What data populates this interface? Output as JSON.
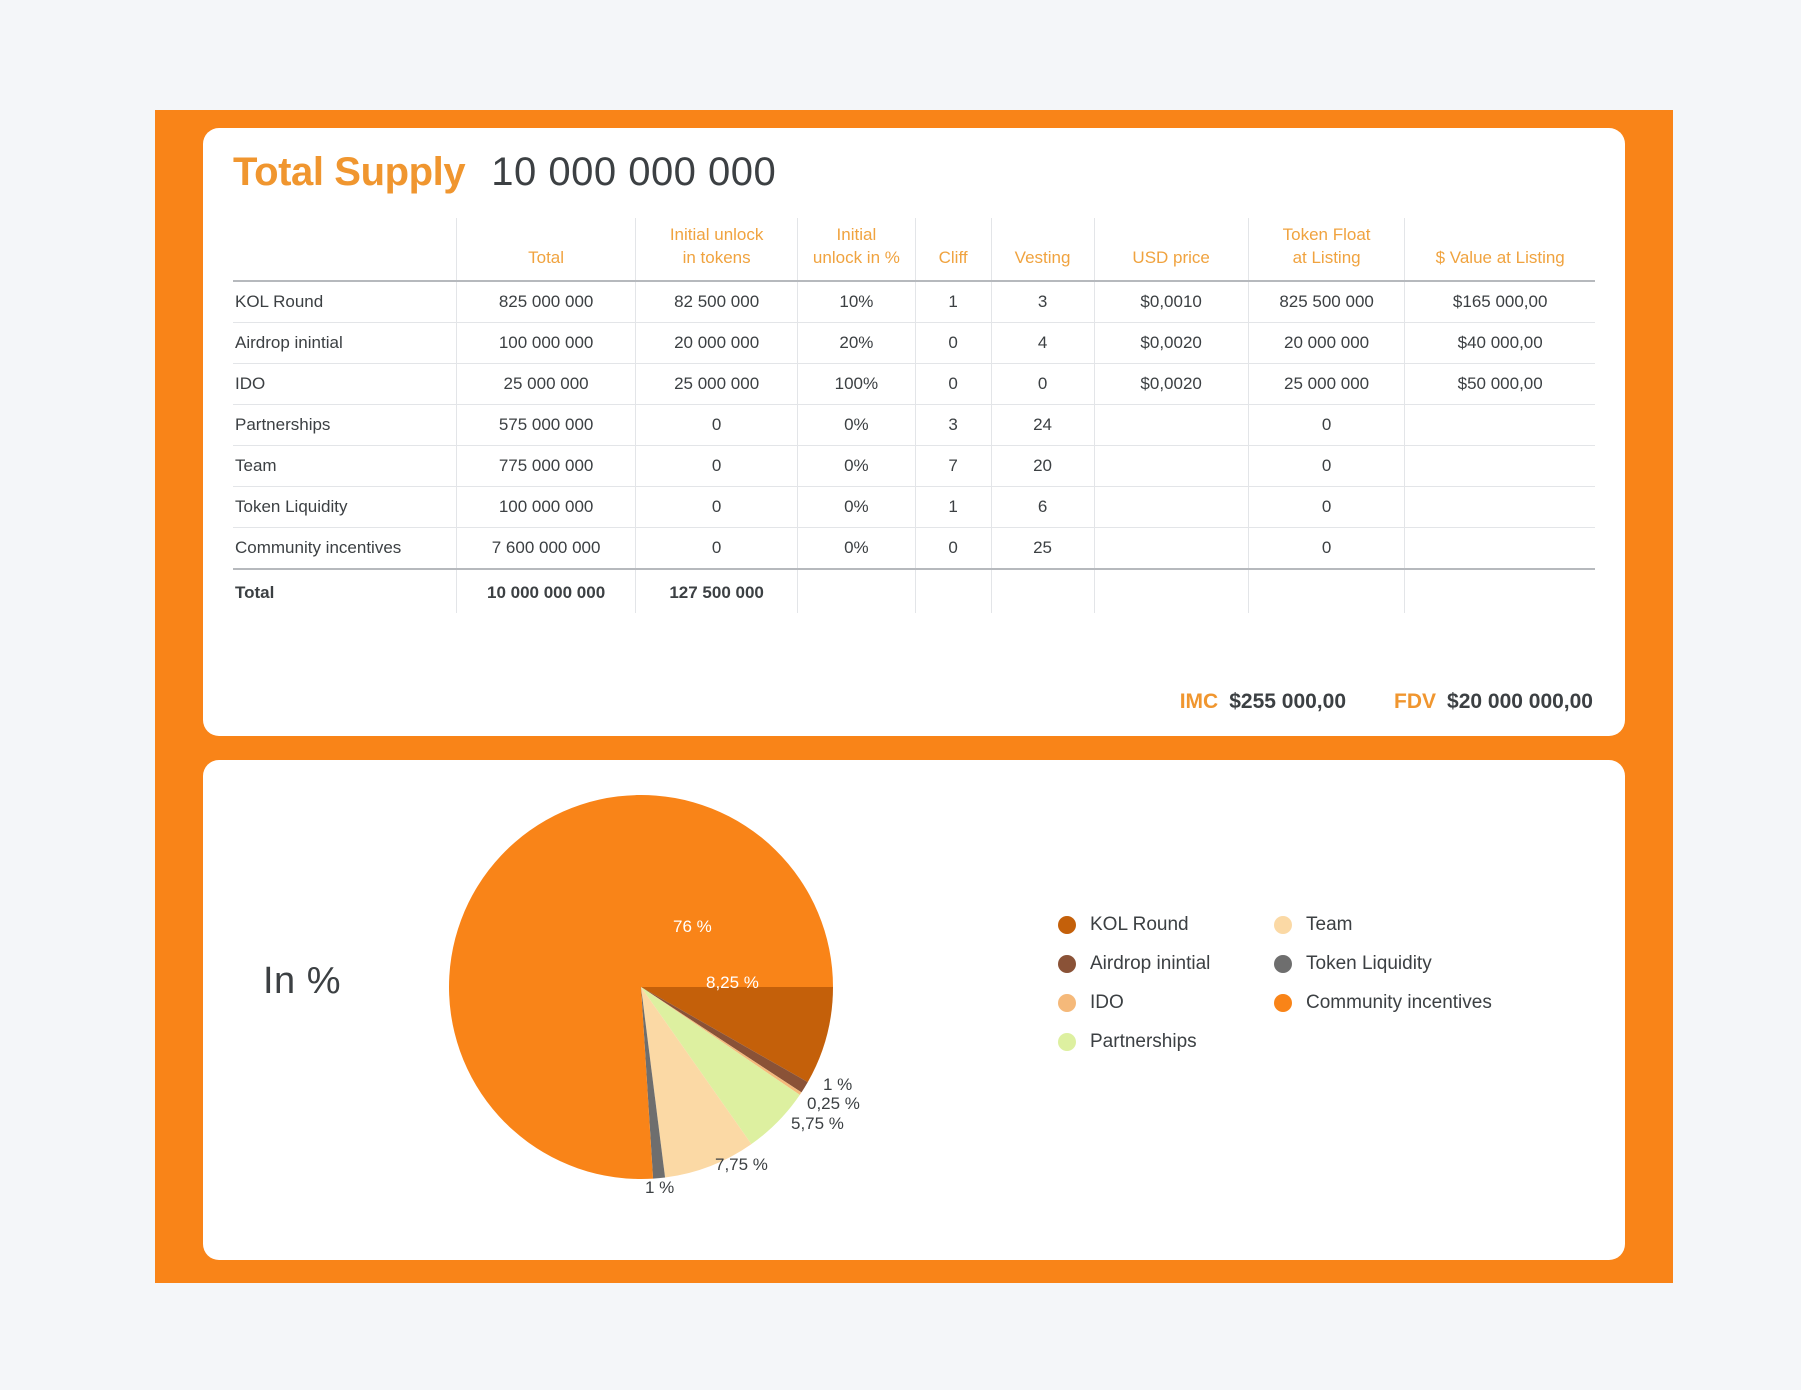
{
  "supply": {
    "title": "Total Supply",
    "total_value": "10 000 000 000",
    "columns": [
      {
        "key": "name",
        "label": ""
      },
      {
        "key": "total",
        "label": "Total"
      },
      {
        "key": "iut",
        "label": "Initial unlock\nin tokens"
      },
      {
        "key": "iup",
        "label": "Initial\nunlock in %"
      },
      {
        "key": "cliff",
        "label": "Cliff"
      },
      {
        "key": "vest",
        "label": "Vesting"
      },
      {
        "key": "usd",
        "label": "USD price"
      },
      {
        "key": "float",
        "label": "Token Float\nat Listing"
      },
      {
        "key": "val",
        "label": "$ Value at Listing"
      }
    ],
    "rows": [
      {
        "name": "KOL Round",
        "total": "825 000 000",
        "iut": "82 500 000",
        "iup": "10%",
        "cliff": "1",
        "vest": "3",
        "usd": "$0,0010",
        "float": "825 500 000",
        "val": "$165 000,00"
      },
      {
        "name": "Airdrop inintial",
        "total": "100 000 000",
        "iut": "20 000 000",
        "iup": "20%",
        "cliff": "0",
        "vest": "4",
        "usd": "$0,0020",
        "float": "20 000 000",
        "val": "$40 000,00"
      },
      {
        "name": "IDO",
        "total": "25 000 000",
        "iut": "25 000 000",
        "iup": "100%",
        "cliff": "0",
        "vest": "0",
        "usd": "$0,0020",
        "float": "25 000 000",
        "val": "$50 000,00"
      },
      {
        "name": "Partnerships",
        "total": "575 000 000",
        "iut": "0",
        "iup": "0%",
        "cliff": "3",
        "vest": "24",
        "usd": "",
        "float": "0",
        "val": ""
      },
      {
        "name": "Team",
        "total": "775 000 000",
        "iut": "0",
        "iup": "0%",
        "cliff": "7",
        "vest": "20",
        "usd": "",
        "float": "0",
        "val": ""
      },
      {
        "name": "Token Liquidity",
        "total": "100 000 000",
        "iut": "0",
        "iup": "0%",
        "cliff": "1",
        "vest": "6",
        "usd": "",
        "float": "0",
        "val": ""
      },
      {
        "name": "Community incentives",
        "total": "7 600 000 000",
        "iut": "0",
        "iup": "0%",
        "cliff": "0",
        "vest": "25",
        "usd": "",
        "float": "0",
        "val": ""
      }
    ],
    "total_row": {
      "name": "Total",
      "total": "10 000 000 000",
      "iut": "127 500 000",
      "iup": "",
      "cliff": "",
      "vest": "",
      "usd": "",
      "float": "",
      "val": ""
    },
    "metrics": [
      {
        "label": "IMC",
        "value": "$255 000,00"
      },
      {
        "label": "FDV",
        "value": "$20 000 000,00"
      }
    ]
  },
  "chart_card": {
    "caption": "In %"
  },
  "chart_data": {
    "type": "pie",
    "title": "In %",
    "unit": "%",
    "legend_position": "right",
    "categories": [
      "KOL Round",
      "Airdrop inintial",
      "IDO",
      "Partnerships",
      "Team",
      "Token Liquidity",
      "Community incentives"
    ],
    "values": [
      8.25,
      1,
      0.25,
      5.75,
      7.75,
      1,
      76
    ],
    "value_labels": [
      "8,25 %",
      "1 %",
      "0,25 %",
      "5,75 %",
      "7,75 %",
      "1 %",
      "76 %"
    ],
    "colors": [
      "#c4600a",
      "#8a5237",
      "#f5b97a",
      "#ddf0a0",
      "#fbd9a5",
      "#6e6e6e",
      "#f98418"
    ],
    "legend": [
      {
        "label": "KOL Round",
        "color": "#c4600a"
      },
      {
        "label": "Airdrop inintial",
        "color": "#8a5237"
      },
      {
        "label": "IDO",
        "color": "#f5b97a"
      },
      {
        "label": "Partnerships",
        "color": "#ddf0a0"
      },
      {
        "label": "Team",
        "color": "#fbd9a5"
      },
      {
        "label": "Token Liquidity",
        "color": "#6e6e6e"
      },
      {
        "label": "Community incentives",
        "color": "#f98418"
      }
    ],
    "annotations": [
      {
        "text": "76 %",
        "inside": true
      },
      {
        "text": "8,25 %",
        "inside": true
      },
      {
        "text": "1 %",
        "inside": false
      },
      {
        "text": "0,25 %",
        "inside": false
      },
      {
        "text": "5,75 %",
        "inside": false
      },
      {
        "text": "7,75 %",
        "inside": false
      },
      {
        "text": "1 %",
        "inside": false
      }
    ]
  },
  "theme": {
    "accent": "#f98418",
    "accent_light": "#f0a33f",
    "text": "#3c4043",
    "page_bg": "#f4f6f9",
    "card_bg": "#ffffff"
  }
}
